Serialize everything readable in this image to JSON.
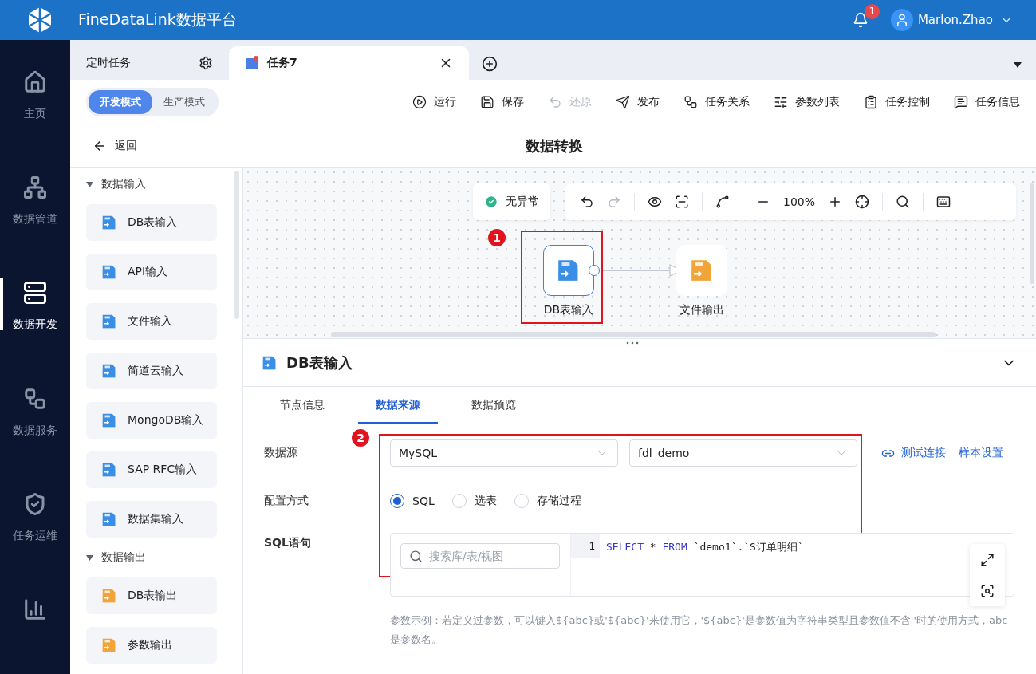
{
  "app": {
    "title": "FineDataLink数据平台",
    "notifications": "1",
    "user": "Marlon.Zhao"
  },
  "nav": [
    {
      "label": "主页",
      "selected": false
    },
    {
      "label": "数据管道",
      "selected": false
    },
    {
      "label": "数据开发",
      "selected": true
    },
    {
      "label": "数据服务",
      "selected": false
    },
    {
      "label": "任务运维",
      "selected": false
    },
    {
      "selected": false
    }
  ],
  "tabs": [
    {
      "label": "定时任务",
      "kind": "settings",
      "selected": false
    },
    {
      "label": "任务7",
      "kind": "task",
      "selected": true
    }
  ],
  "modes": [
    {
      "label": "开发模式",
      "selected": true
    },
    {
      "label": "生产模式",
      "selected": false
    }
  ],
  "actions": [
    {
      "label": "运行",
      "disabled": false
    },
    {
      "label": "保存",
      "disabled": false
    },
    {
      "label": "还原",
      "disabled": true
    },
    {
      "label": "发布",
      "disabled": false
    },
    {
      "label": "任务关系",
      "disabled": false
    },
    {
      "label": "参数列表",
      "disabled": false
    },
    {
      "label": "任务控制",
      "disabled": false
    },
    {
      "label": "任务信息",
      "disabled": false
    }
  ],
  "back": "返回",
  "page_title": "数据转换",
  "palette": [
    {
      "title": "数据输入",
      "expanded": true,
      "items": [
        "DB表输入",
        "API输入",
        "文件输入",
        "简道云输入",
        "MongoDB输入",
        "SAP RFC输入",
        "数据集输入"
      ]
    },
    {
      "title": "数据输出",
      "expanded": true,
      "items": [
        "DB表输出",
        "参数输出"
      ]
    }
  ],
  "canvas": {
    "status": "无异常",
    "zoom": "100%",
    "nodes": [
      {
        "label": "DB表输入",
        "kind": "db",
        "selected": true,
        "marker": "1"
      },
      {
        "label": "文件输出",
        "kind": "fileout",
        "selected": false
      }
    ]
  },
  "panel": {
    "title": "DB表输入",
    "tabs": [
      {
        "label": "节点信息",
        "selected": false
      },
      {
        "label": "数据来源",
        "selected": true
      },
      {
        "label": "数据预览",
        "selected": false
      }
    ],
    "marker": "2",
    "datasource_label": "数据源",
    "selects": [
      "MySQL",
      "fdl_demo"
    ],
    "links": [
      "测试连接",
      "样本设置"
    ],
    "config_label": "配置方式",
    "radios": [
      {
        "label": "SQL",
        "selected": true
      },
      {
        "label": "选表",
        "selected": false
      },
      {
        "label": "存储过程",
        "selected": false
      }
    ],
    "sql_label": "SQL语句",
    "search_placeholder": "搜索库/表/视图",
    "line_number": "1",
    "code": [
      {
        "text": "SELECT",
        "kind": "keyword"
      },
      {
        "text": " * ",
        "kind": "plain"
      },
      {
        "text": "FROM",
        "kind": "keyword"
      },
      {
        "text": " `demo1`.`S订单明细`",
        "kind": "plain"
      }
    ],
    "hint": "参数示例：若定义过参数，可以键入${abc}或'${abc}'来使用它，'${abc}'是参数值为字符串类型且参数值不含''时的使用方式，abc是参数名。"
  }
}
